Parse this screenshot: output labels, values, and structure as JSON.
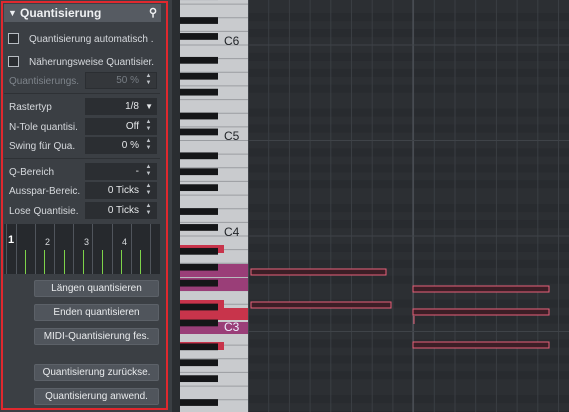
{
  "panel": {
    "title": "Quantisierung",
    "search_icon": "search-icon",
    "auto_quantize_label": "Quantisierung automatisch .",
    "approx_quantize_label": "Näherungsweise Quantisier.",
    "quant_strength_label": "Quantisierungs.",
    "quant_strength_value": "50 %",
    "grid_type_label": "Rastertyp",
    "grid_type_value": "1/8",
    "ntole_label": "N-Tole quantisi.",
    "ntole_value": "Off",
    "swing_label": "Swing für Qua.",
    "swing_value": "0 %",
    "q_range_label": "Q-Bereich",
    "q_range_value": "-",
    "exclude_range_label": "Ausspar-Bereic.",
    "exclude_range_value": "0 Ticks",
    "loose_label": "Lose Quantisie.",
    "loose_value": "0 Ticks",
    "grid_numbers": [
      "1",
      "2",
      "3",
      "4"
    ],
    "btn_lengths": "Längen quantisieren",
    "btn_ends": "Enden quantisieren",
    "btn_midi_fix": "MIDI-Quantisierung fes.",
    "btn_reset": "Quantisierung zurückse.",
    "btn_apply": "Quantisierung anwend."
  },
  "keyboard": {
    "labels": [
      "C6",
      "C5",
      "C4",
      "C3"
    ]
  },
  "colors": {
    "panel_border": "#e0282e",
    "note_fill": "#3c1e26",
    "note_border": "#e7607a",
    "key_highlight": "#c8344b",
    "key_highlight_alt": "#9a3e78",
    "grid_tick": "#7dd34a"
  }
}
